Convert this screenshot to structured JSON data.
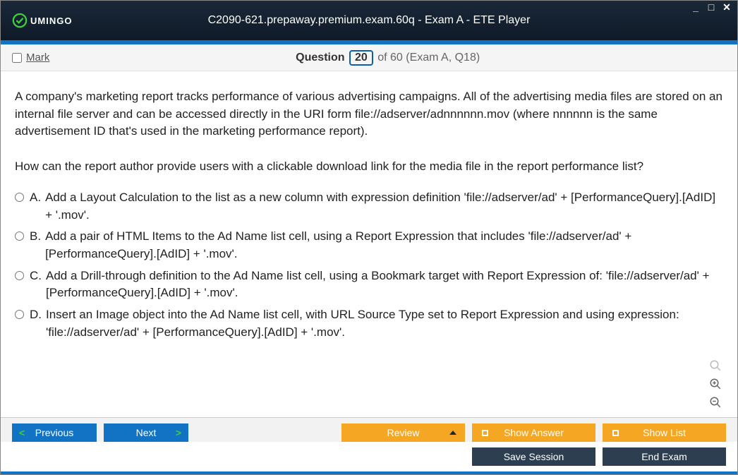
{
  "titlebar": {
    "logo_text": "UMINGO",
    "title": "C2090-621.prepaway.premium.exam.60q - Exam A - ETE Player"
  },
  "questionbar": {
    "mark_label": "Mark",
    "prefix": "Question",
    "current": "20",
    "suffix": "of 60 (Exam A, Q18)"
  },
  "question": {
    "prompt_p1": "A company's marketing report tracks performance of various advertising campaigns. All of the advertising media files are stored on an internal file server and can be accessed directly in the URI form file://adserver/adnnnnnn.mov (where nnnnnn is the same advertisement ID that's used in the marketing performance report).",
    "prompt_p2": "How can the report author provide users with a clickable download link for the media file in the report performance list?",
    "options": [
      {
        "letter": "A.",
        "text": "Add a Layout Calculation to the list as a new column with expression definition 'file://adserver/ad' + [PerformanceQuery].[AdID] + '.mov'."
      },
      {
        "letter": "B.",
        "text": "Add a pair of HTML Items to the Ad Name list cell, using a Report Expression that includes 'file://adserver/ad' + [PerformanceQuery].[AdID] + '.mov'."
      },
      {
        "letter": "C.",
        "text": "Add a Drill-through definition to the Ad Name list cell, using a Bookmark target with Report Expression of: 'file://adserver/ad' + [PerformanceQuery].[AdID] + '.mov'."
      },
      {
        "letter": "D.",
        "text": "Insert an Image object into the Ad Name list cell, with URL Source Type set to Report Expression and using expression: 'file://adserver/ad' + [PerformanceQuery].[AdID] + '.mov'."
      }
    ]
  },
  "buttons": {
    "previous": "Previous",
    "next": "Next",
    "review": "Review",
    "show_answer": "Show Answer",
    "show_list": "Show List",
    "save_session": "Save Session",
    "end_exam": "End Exam"
  }
}
